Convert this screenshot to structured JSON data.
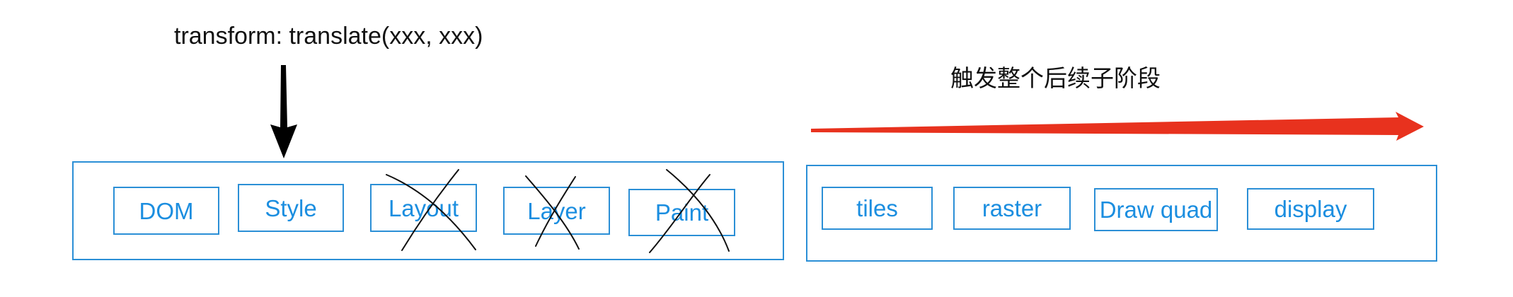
{
  "captions": {
    "transform": "transform: translate(xxx, xxx)",
    "trigger": "触发整个后续子阶段"
  },
  "main_thread": {
    "stages": [
      {
        "label": "DOM",
        "skipped": false
      },
      {
        "label": "Style",
        "skipped": false
      },
      {
        "label": "Layout",
        "skipped": true
      },
      {
        "label": "Layer",
        "skipped": true
      },
      {
        "label": "Paint",
        "skipped": true
      }
    ]
  },
  "compositor": {
    "stages": [
      {
        "label": "tiles"
      },
      {
        "label": "raster"
      },
      {
        "label": "Draw quad"
      },
      {
        "label": "display"
      }
    ]
  },
  "colors": {
    "stage_text": "#1b8ee0",
    "stage_border": "#2b8fd6",
    "down_arrow": "#000000",
    "trigger_arrow": "#e8321e",
    "cross_mark": "#111111"
  }
}
